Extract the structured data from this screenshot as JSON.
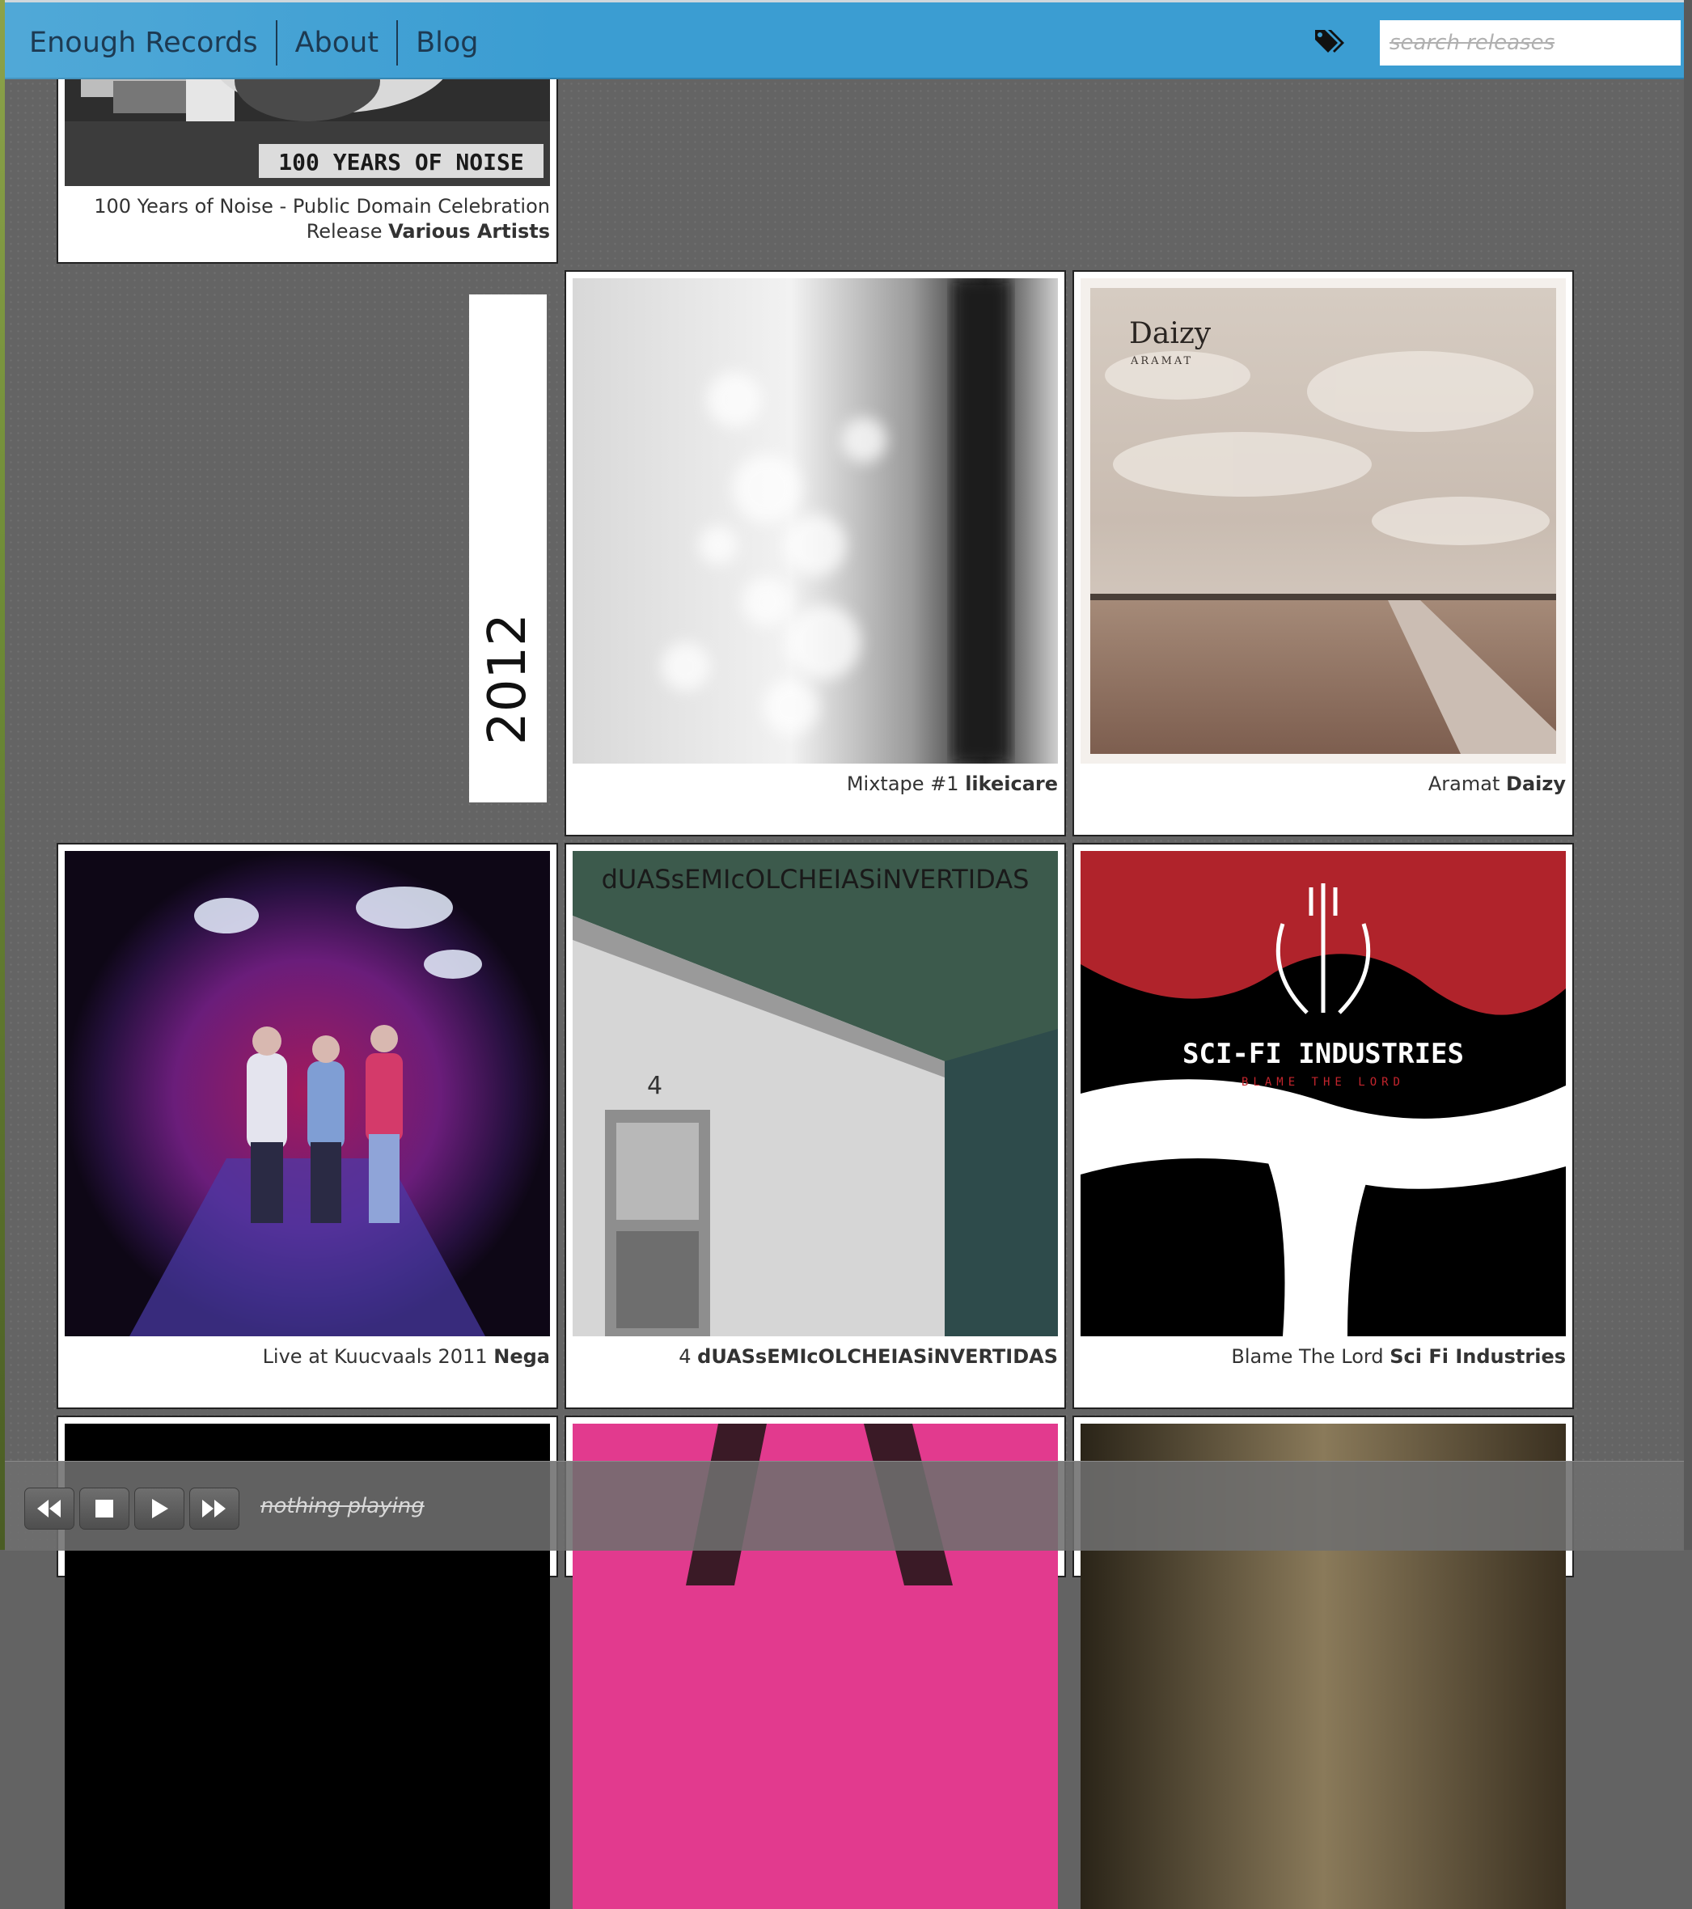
{
  "nav": {
    "brand": "Enough Records",
    "about": "About",
    "blog": "Blog"
  },
  "search": {
    "placeholder": "search releases"
  },
  "year_label": "2012",
  "releases": [
    {
      "title": "100 Years of Noise - Public Domain Celebration",
      "title_line2": "Release",
      "artist": "Various Artists",
      "cover_text": "100 YEARS OF NOISE"
    },
    {
      "title": "Mixtape #1",
      "artist": "likeicare"
    },
    {
      "title": "Aramat",
      "artist": "Daizy",
      "cover_title": "Daizy",
      "cover_subtitle": "ARAMAT"
    },
    {
      "title": "Live at Kuucvaals 2011",
      "artist": "Nega"
    },
    {
      "title": "4",
      "artist": "dUASsEMIcOLCHEIASiNVERTIDAS",
      "cover_title": "dUASsEMIcOLCHEIASiNVERTIDAS",
      "cover_number": "4"
    },
    {
      "title": "Blame The Lord",
      "artist": "Sci Fi Industries",
      "cover_title": "SCI-FI INDUSTRIES",
      "cover_subtitle": "BLAME THE LORD"
    }
  ],
  "player": {
    "status": "nothing playing"
  },
  "icons": [
    "tags-icon",
    "rewind-icon",
    "stop-icon",
    "play-icon",
    "fast-forward-icon"
  ],
  "colors": {
    "topbar": "#3b9dd2",
    "nav_text": "#1d3a52",
    "background": "#646464",
    "card": "#ffffff"
  }
}
